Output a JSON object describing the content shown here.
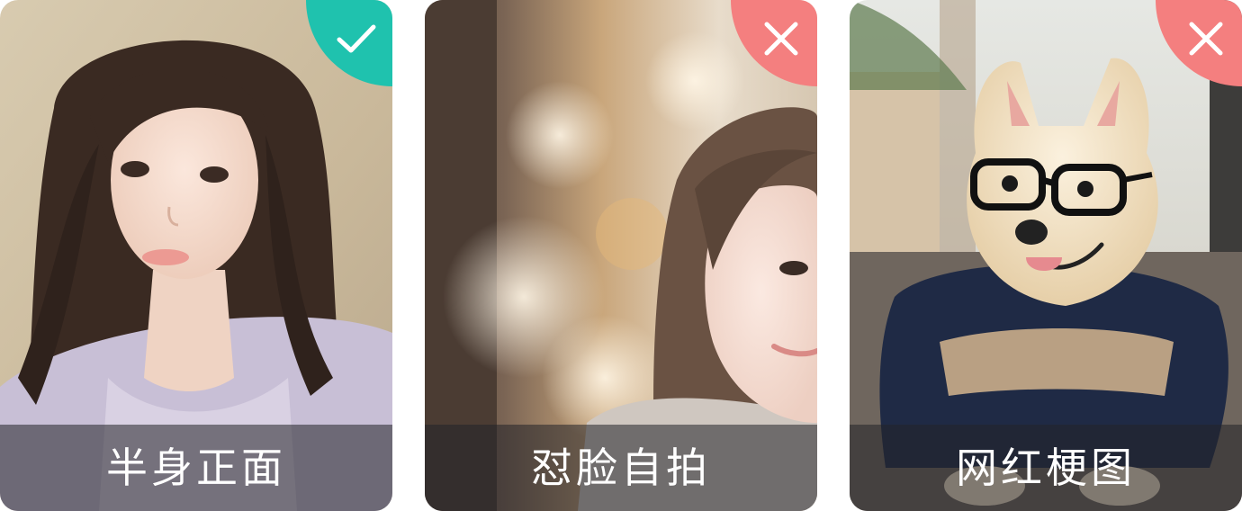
{
  "cards": [
    {
      "caption": "半身正面",
      "status": "correct",
      "status_icon": "check-icon",
      "badge_color": "#1fc2ae"
    },
    {
      "caption": "怼脸自拍",
      "status": "wrong",
      "status_icon": "cross-icon",
      "badge_color": "#f47f7f"
    },
    {
      "caption": "网红梗图",
      "status": "wrong",
      "status_icon": "cross-icon",
      "badge_color": "#f47f7f"
    }
  ]
}
